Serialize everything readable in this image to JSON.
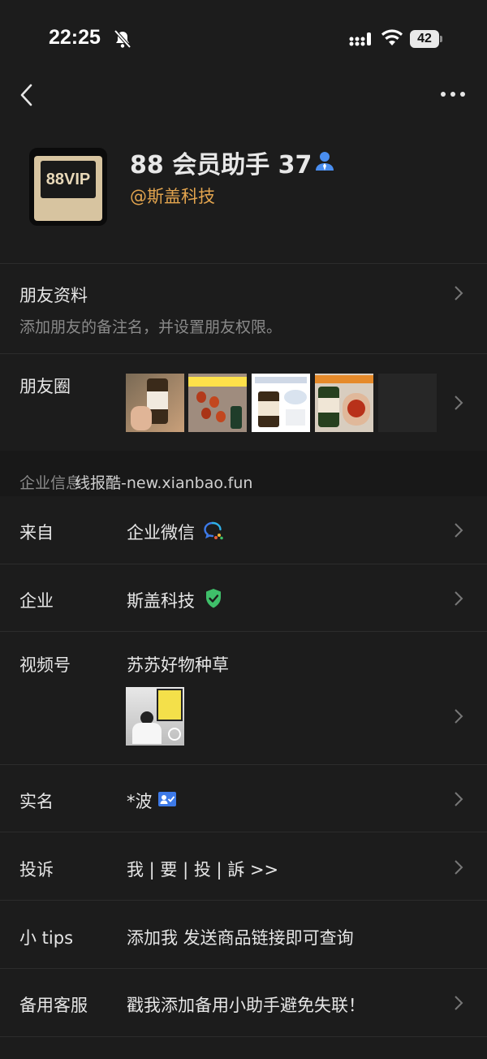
{
  "status_bar": {
    "time": "22:25",
    "battery": "42"
  },
  "profile": {
    "avatar_text": "88VIP",
    "name": "88 会员助手 37",
    "company_handle": "@斯盖科技"
  },
  "friend_info": {
    "label": "朋友资料",
    "hint": "添加朋友的备注名，并设置朋友权限。"
  },
  "moments": {
    "label": "朋友圈"
  },
  "enterprise_section": {
    "title": "企业信息",
    "watermark": "线报酷-new.xianbao.fun"
  },
  "rows": {
    "from": {
      "label": "来自",
      "value": "企业微信"
    },
    "enterprise": {
      "label": "企业",
      "value": "斯盖科技"
    },
    "channels": {
      "label": "视频号",
      "value": "苏苏好物种草"
    },
    "realname": {
      "label": "实名",
      "value": "*波"
    },
    "complaint": {
      "label": "投诉",
      "value": "我 | 要 | 投 | 訴 >>"
    },
    "tips": {
      "label": "小 tips",
      "value": "添加我 发送商品链接即可查询"
    },
    "backup": {
      "label": "备用客服",
      "value": "戳我添加备用小助手避免失联！"
    }
  },
  "colors": {
    "background": "#1c1c1c",
    "company_orange": "#e2a44e",
    "verified_green": "#3fbf6a",
    "accent_blue": "#3d7ae8"
  }
}
